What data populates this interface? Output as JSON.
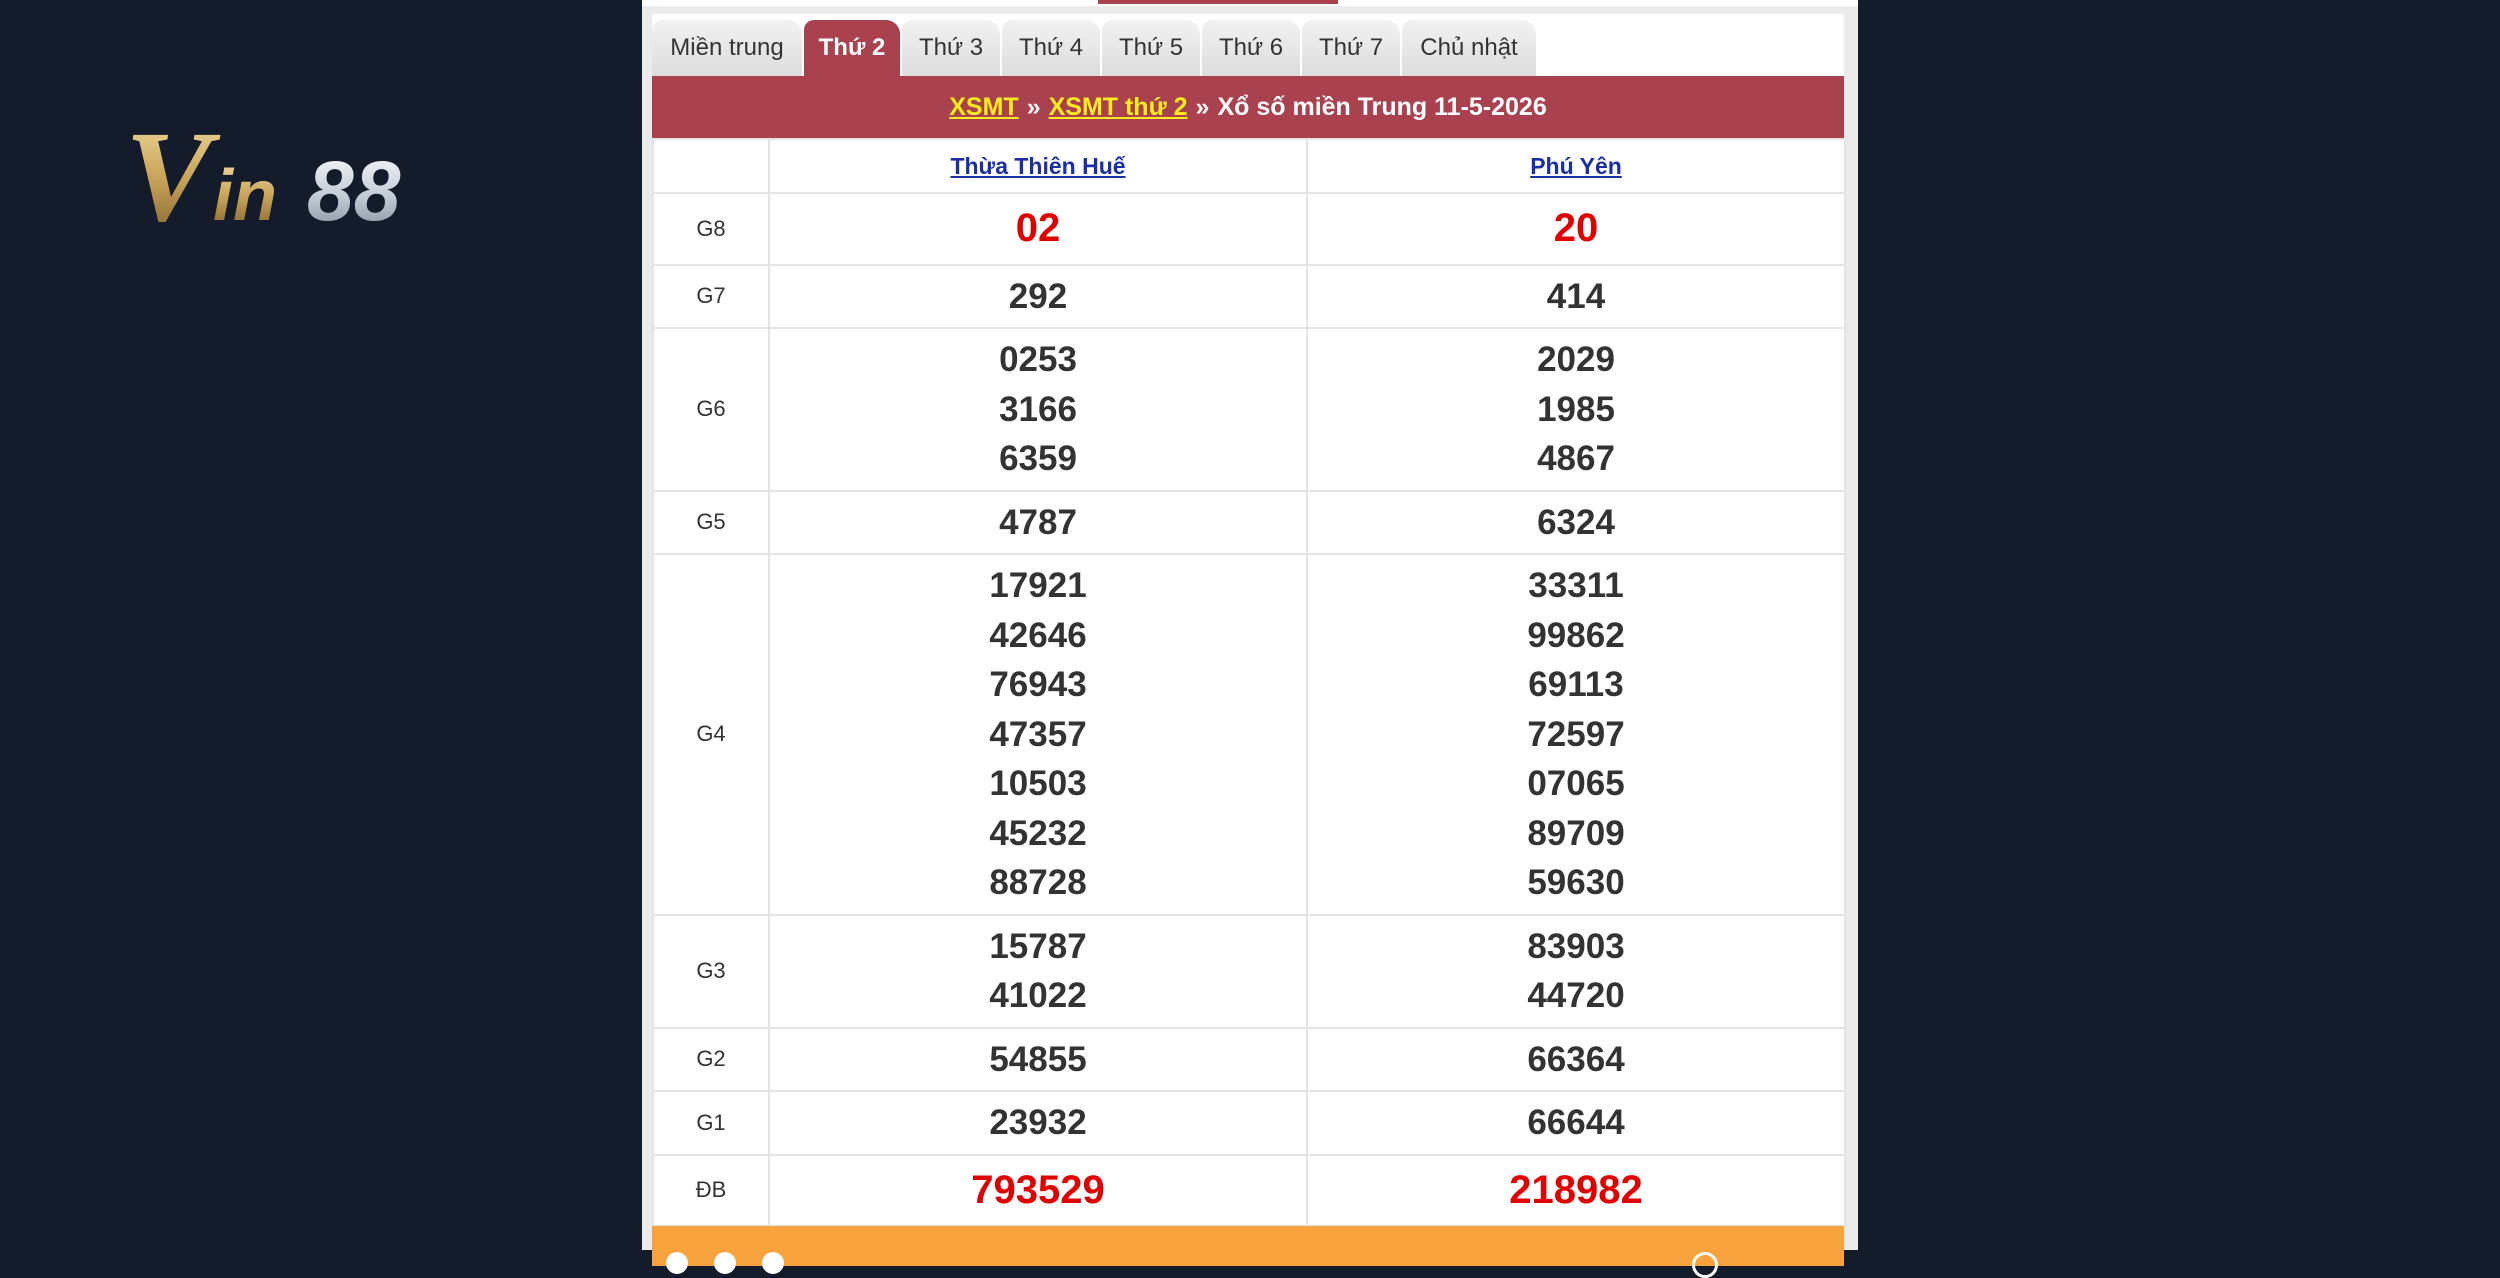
{
  "brand": {
    "logo_text": "Vin88"
  },
  "tabs": [
    {
      "label": "Miền trung",
      "active": false
    },
    {
      "label": "Thứ 2",
      "active": true
    },
    {
      "label": "Thứ 3",
      "active": false
    },
    {
      "label": "Thứ 4",
      "active": false
    },
    {
      "label": "Thứ 5",
      "active": false
    },
    {
      "label": "Thứ 6",
      "active": false
    },
    {
      "label": "Thứ 7",
      "active": false
    },
    {
      "label": "Chủ nhật",
      "active": false
    }
  ],
  "title": {
    "link1": "XSMT",
    "sep1": "»",
    "link2": "XSMT thứ 2",
    "sep2": "»",
    "text": "Xổ số miền Trung 11-5-2026"
  },
  "provinces": [
    "Thừa Thiên Huế",
    "Phú Yên"
  ],
  "prizes": [
    {
      "label": "G8",
      "style": "red",
      "values": [
        [
          "02"
        ],
        [
          "20"
        ]
      ]
    },
    {
      "label": "G7",
      "style": "normal",
      "values": [
        [
          "292"
        ],
        [
          "414"
        ]
      ]
    },
    {
      "label": "G6",
      "style": "normal",
      "values": [
        [
          "0253",
          "3166",
          "6359"
        ],
        [
          "2029",
          "1985",
          "4867"
        ]
      ]
    },
    {
      "label": "G5",
      "style": "normal",
      "values": [
        [
          "4787"
        ],
        [
          "6324"
        ]
      ]
    },
    {
      "label": "G4",
      "style": "normal",
      "values": [
        [
          "17921",
          "42646",
          "76943",
          "47357",
          "10503",
          "45232",
          "88728"
        ],
        [
          "33311",
          "99862",
          "69113",
          "72597",
          "07065",
          "89709",
          "59630"
        ]
      ]
    },
    {
      "label": "G3",
      "style": "normal",
      "values": [
        [
          "15787",
          "41022"
        ],
        [
          "83903",
          "44720"
        ]
      ]
    },
    {
      "label": "G2",
      "style": "normal",
      "values": [
        [
          "54855"
        ],
        [
          "66364"
        ]
      ]
    },
    {
      "label": "G1",
      "style": "normal",
      "values": [
        [
          "23932"
        ],
        [
          "66644"
        ]
      ]
    },
    {
      "label": "ĐB",
      "style": "red",
      "values": [
        [
          "793529"
        ],
        [
          "218982"
        ]
      ]
    }
  ],
  "colors": {
    "accent": "#a9414f",
    "link_yellow": "#ffec1c",
    "number_red": "#e00000",
    "footer_orange": "#f7a23c",
    "background": "#141c2b"
  }
}
